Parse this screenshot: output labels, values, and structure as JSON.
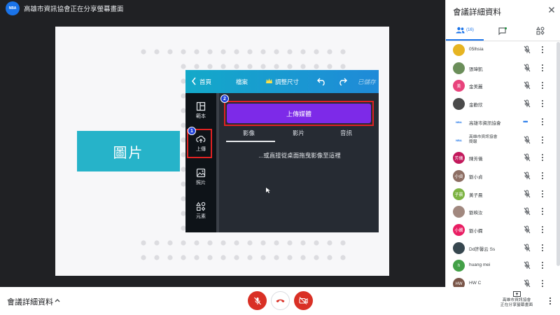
{
  "presenter": {
    "logo_text": "NBA",
    "banner_text": "高雄市資訊協會正在分享螢幕畫面"
  },
  "slide": {
    "picture_label": "圖片"
  },
  "canva": {
    "topbar": {
      "home": "首頁",
      "file": "檔案",
      "resize": "調整尺寸",
      "saved": "已儲存"
    },
    "sidebar": [
      {
        "label": "範本",
        "icon": "template-icon"
      },
      {
        "label": "上傳",
        "icon": "upload-cloud-icon"
      },
      {
        "label": "照片",
        "icon": "photo-icon"
      },
      {
        "label": "元素",
        "icon": "elements-icon"
      }
    ],
    "upload_button": "上傳媒體",
    "tabs": [
      "影像",
      "影片",
      "音訊"
    ],
    "drag_hint": "...或直接從桌面拖曳影像至這裡",
    "badge_1": "1",
    "badge_2": "2"
  },
  "panel": {
    "title": "會議詳細資料",
    "people_count": "(16)",
    "participants": [
      {
        "name": "05lhsia",
        "avatar_text": "",
        "color": "#e6b422",
        "status": "muted"
      },
      {
        "name": "張瑋凱",
        "avatar_text": "",
        "color": "#6b8e5a",
        "status": "muted"
      },
      {
        "name": "金美麗",
        "avatar_text": "美",
        "color": "#e8437c",
        "status": "muted"
      },
      {
        "name": "金歡欣",
        "avatar_text": "",
        "color": "#4a4a4a",
        "status": "muted"
      },
      {
        "name": "高雄市資訊協會",
        "avatar_text": "NBA",
        "color": "#ffffff",
        "status": "speaking"
      },
      {
        "name": "高雄市資訊協會",
        "subtitle": "簡報",
        "avatar_text": "NBA",
        "color": "#ffffff",
        "status": "muted"
      },
      {
        "name": "陳芳儀",
        "avatar_text": "芳儀",
        "color": "#c2185b",
        "status": "muted"
      },
      {
        "name": "劉小貞",
        "avatar_text": "小貞",
        "color": "#8d6e63",
        "status": "muted"
      },
      {
        "name": "黃子晨",
        "avatar_text": "子晨",
        "color": "#7cb342",
        "status": "muted"
      },
      {
        "name": "劉映汝",
        "avatar_text": "",
        "color": "#a1887f",
        "status": "muted"
      },
      {
        "name": "劉小嫻",
        "avatar_text": "小嫻",
        "color": "#e91e63",
        "status": "muted"
      },
      {
        "name": "Dd許馨云 Ss",
        "avatar_text": "",
        "color": "#37474f",
        "status": "muted"
      },
      {
        "name": "huang mei",
        "avatar_text": "h",
        "color": "#43a047",
        "status": "muted"
      },
      {
        "name": "HW C",
        "avatar_text": "HW",
        "color": "#795548",
        "status": "muted"
      }
    ]
  },
  "bottom": {
    "meeting_details": "會議詳細資料",
    "presenting_line1": "高雄市資訊協會",
    "presenting_line2": "正在分享螢幕畫面"
  },
  "colors": {
    "accent": "#1a73e8",
    "danger": "#d93025",
    "canva_purple": "#7d2ae8",
    "picture_box": "#26b3c9"
  }
}
